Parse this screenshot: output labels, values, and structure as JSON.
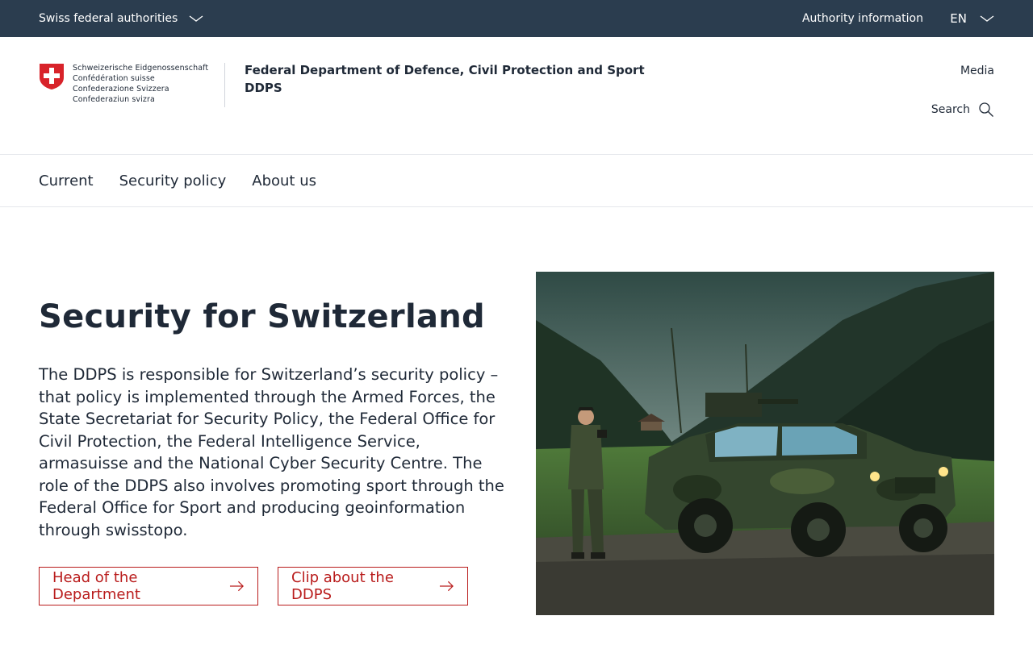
{
  "topbar": {
    "federal_authorities": "Swiss federal authorities",
    "authority_information": "Authority information",
    "language": "EN"
  },
  "header": {
    "logo_lines": [
      "Schweizerische Eidgenossenschaft",
      "Confédération suisse",
      "Confederazione Svizzera",
      "Confederaziun svizra"
    ],
    "department_name": "Federal Department of Defence, Civil Protection and Sport",
    "department_abbr": "DDPS",
    "media_link": "Media",
    "search_label": "Search"
  },
  "main_nav": {
    "items": [
      {
        "label": "Current"
      },
      {
        "label": "Security policy"
      },
      {
        "label": "About us"
      }
    ]
  },
  "hero": {
    "title": "Security for Switzerland",
    "body": "The DDPS is responsible for Switzerland’s security policy – that policy is implemented through the Armed Forces, the State Secretariat for Security Policy, the Federal Office for Civil Protection, the Federal Intelligence Service, armasuisse and the National Cyber Security Centre. The role of the DDPS also involves promoting sport through the Federal Office for Sport and producing geoinformation through swisstopo.",
    "buttons": [
      {
        "label": "Head of the Department"
      },
      {
        "label": "Clip about the DDPS"
      }
    ]
  },
  "colors": {
    "topbar_bg": "#2b3d4f",
    "accent_red": "#b91c1c",
    "text": "#1f2937"
  },
  "icons": {
    "federal_chevron": "chevron-down-icon",
    "language_chevron": "chevron-down-icon",
    "search": "search-icon",
    "button_arrow": "arrow-right-icon",
    "logo": "swiss-cross-shield-icon"
  }
}
